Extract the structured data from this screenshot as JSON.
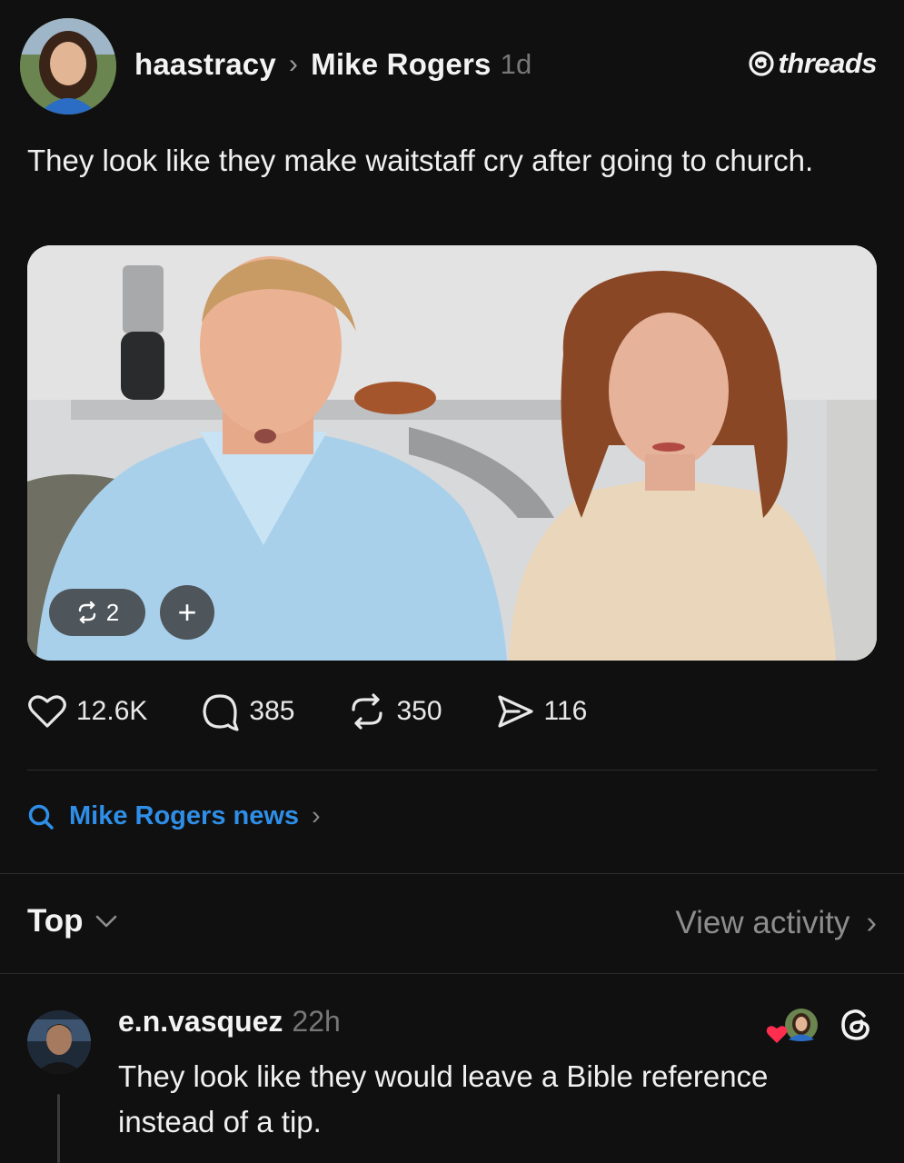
{
  "post": {
    "author": "haastracy",
    "separator": "›",
    "reply_to": "Mike Rogers",
    "time": "1d",
    "brand": "threads",
    "text": "They look like they make waitstaff cry after going to church.",
    "media": {
      "repost_count": "2",
      "add_label": "+"
    },
    "stats": {
      "likes": "12.6K",
      "replies": "385",
      "reposts": "350",
      "shares": "116"
    }
  },
  "related_search": {
    "label": "Mike Rogers news",
    "chevron": "›"
  },
  "sort_bar": {
    "sort_label": "Top",
    "view_activity": "View activity",
    "chevron": "›"
  },
  "comment": {
    "author": "e.n.vasquez",
    "time": "22h",
    "text": "They look like they would leave a Bible reference instead of a tip."
  },
  "colors": {
    "background": "#101010",
    "link_blue": "#2f8fe8",
    "like_red": "#ff2e4e"
  },
  "icons": [
    "heart-icon",
    "comment-icon",
    "repost-icon",
    "share-icon",
    "search-icon",
    "threads-logo-icon",
    "chevron-down-icon",
    "chevron-right-icon"
  ]
}
